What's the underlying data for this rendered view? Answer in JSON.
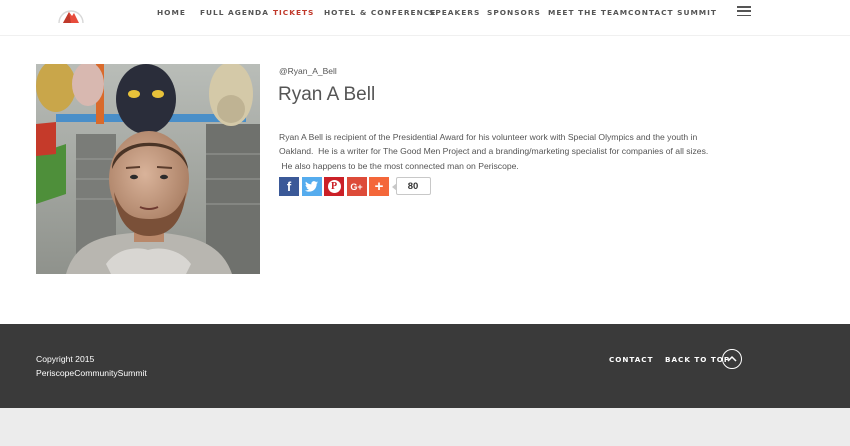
{
  "header": {
    "logo_icon": "periscope-logo-icon",
    "nav": [
      {
        "label": "HOME"
      },
      {
        "label": "FULL AGENDA"
      },
      {
        "label": "TICKETS",
        "active": true
      },
      {
        "label": "HOTEL & CONFERENCE"
      },
      {
        "label": "SPEAKERS"
      },
      {
        "label": "SPONSORS"
      },
      {
        "label": "MEET THE TEAM"
      },
      {
        "label": "CONTACT SUMMIT"
      }
    ],
    "menu_icon": "hamburger-menu-icon",
    "active_color": "#c0392b"
  },
  "profile": {
    "handle": "@Ryan_A_Bell",
    "name": "Ryan A Bell",
    "bio_lines": [
      "Ryan A Bell is recipient of the Presidential Award for his volunteer work with Special Olympics and the youth in",
      "Oakland.  He is a writer for The Good Men Project and a branding/marketing specialist for companies of all sizes.",
      " He also happens to be the most connected man on Periscope."
    ]
  },
  "share": {
    "buttons": [
      {
        "glyph": "f",
        "icon": "facebook-icon",
        "color": "#3b5998"
      },
      {
        "glyph": "t",
        "icon": "twitter-icon",
        "color": "#55acee"
      },
      {
        "glyph": "P",
        "icon": "pinterest-icon",
        "color": "#cb2027"
      },
      {
        "glyph": "G+",
        "icon": "google-plus-icon",
        "color": "#dd4b39"
      },
      {
        "glyph": "+",
        "icon": "more-share-icon",
        "color": "#f4673a"
      }
    ],
    "count": "80"
  },
  "footer": {
    "copyright_line1": "Copyright 2015",
    "copyright_line2": "PeriscopeCommunitySummit",
    "contact": "CONTACT",
    "back_to_top": "BACK TO TOP",
    "back_to_top_icon": "chevron-up-circle-icon",
    "background": "#3a3a3a"
  }
}
